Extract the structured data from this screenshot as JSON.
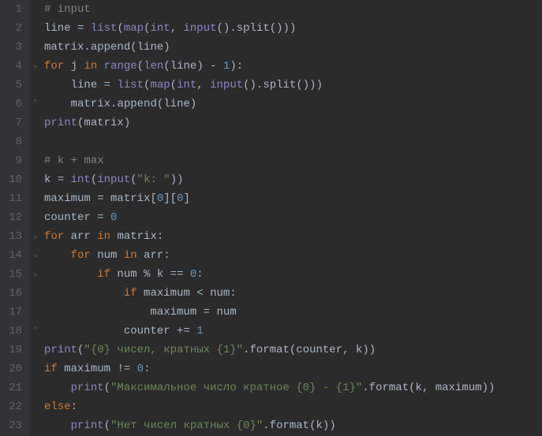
{
  "lines": [
    {
      "n": 1,
      "indent": 0,
      "fold": "",
      "tokens": [
        [
          "comment",
          "# input"
        ]
      ]
    },
    {
      "n": 2,
      "indent": 0,
      "fold": "",
      "tokens": [
        [
          "ident",
          "line "
        ],
        [
          "punct",
          "= "
        ],
        [
          "builtin",
          "list"
        ],
        [
          "punct",
          "("
        ],
        [
          "builtin",
          "map"
        ],
        [
          "punct",
          "("
        ],
        [
          "builtin",
          "int"
        ],
        [
          "punct",
          ", "
        ],
        [
          "builtin",
          "input"
        ],
        [
          "punct",
          "()."
        ],
        [
          "ident",
          "split"
        ],
        [
          "punct",
          "()))"
        ]
      ]
    },
    {
      "n": 3,
      "indent": 0,
      "fold": "",
      "tokens": [
        [
          "ident",
          "matrix"
        ],
        [
          "punct",
          "."
        ],
        [
          "ident",
          "append"
        ],
        [
          "punct",
          "("
        ],
        [
          "ident",
          "line"
        ],
        [
          "punct",
          ")"
        ]
      ]
    },
    {
      "n": 4,
      "indent": 0,
      "fold": "open",
      "tokens": [
        [
          "keyword",
          "for"
        ],
        [
          "ident",
          " j "
        ],
        [
          "keyword",
          "in"
        ],
        [
          "ident",
          " "
        ],
        [
          "builtin",
          "range"
        ],
        [
          "punct",
          "("
        ],
        [
          "builtin",
          "len"
        ],
        [
          "punct",
          "("
        ],
        [
          "ident",
          "line"
        ],
        [
          "punct",
          ") - "
        ],
        [
          "number",
          "1"
        ],
        [
          "punct",
          "):"
        ]
      ]
    },
    {
      "n": 5,
      "indent": 1,
      "fold": "",
      "tokens": [
        [
          "ident",
          "line "
        ],
        [
          "punct",
          "= "
        ],
        [
          "builtin",
          "list"
        ],
        [
          "punct",
          "("
        ],
        [
          "builtin",
          "map"
        ],
        [
          "punct",
          "("
        ],
        [
          "builtin",
          "int"
        ],
        [
          "punct",
          ", "
        ],
        [
          "builtin",
          "input"
        ],
        [
          "punct",
          "()."
        ],
        [
          "ident",
          "split"
        ],
        [
          "punct",
          "()))"
        ]
      ]
    },
    {
      "n": 6,
      "indent": 1,
      "fold": "close",
      "tokens": [
        [
          "ident",
          "matrix"
        ],
        [
          "punct",
          "."
        ],
        [
          "ident",
          "append"
        ],
        [
          "punct",
          "("
        ],
        [
          "ident",
          "line"
        ],
        [
          "punct",
          ")"
        ]
      ]
    },
    {
      "n": 7,
      "indent": 0,
      "fold": "",
      "tokens": [
        [
          "builtin",
          "print"
        ],
        [
          "punct",
          "("
        ],
        [
          "ident",
          "matrix"
        ],
        [
          "punct",
          ")"
        ]
      ]
    },
    {
      "n": 8,
      "indent": 0,
      "fold": "",
      "tokens": []
    },
    {
      "n": 9,
      "indent": 0,
      "fold": "",
      "tokens": [
        [
          "comment",
          "# k + max"
        ]
      ]
    },
    {
      "n": 10,
      "indent": 0,
      "fold": "",
      "tokens": [
        [
          "ident",
          "k "
        ],
        [
          "punct",
          "= "
        ],
        [
          "builtin",
          "int"
        ],
        [
          "punct",
          "("
        ],
        [
          "builtin",
          "input"
        ],
        [
          "punct",
          "("
        ],
        [
          "string",
          "\"k: \""
        ],
        [
          "punct",
          "))"
        ]
      ]
    },
    {
      "n": 11,
      "indent": 0,
      "fold": "",
      "tokens": [
        [
          "ident",
          "maximum "
        ],
        [
          "punct",
          "= "
        ],
        [
          "ident",
          "matrix"
        ],
        [
          "punct",
          "["
        ],
        [
          "number",
          "0"
        ],
        [
          "punct",
          "]["
        ],
        [
          "number",
          "0"
        ],
        [
          "punct",
          "]"
        ]
      ]
    },
    {
      "n": 12,
      "indent": 0,
      "fold": "",
      "tokens": [
        [
          "ident",
          "counter "
        ],
        [
          "punct",
          "= "
        ],
        [
          "number",
          "0"
        ]
      ]
    },
    {
      "n": 13,
      "indent": 0,
      "fold": "open",
      "tokens": [
        [
          "keyword",
          "for"
        ],
        [
          "ident",
          " arr "
        ],
        [
          "keyword",
          "in"
        ],
        [
          "ident",
          " matrix"
        ],
        [
          "punct",
          ":"
        ]
      ]
    },
    {
      "n": 14,
      "indent": 1,
      "fold": "open",
      "tokens": [
        [
          "keyword",
          "for"
        ],
        [
          "ident",
          " num "
        ],
        [
          "keyword",
          "in"
        ],
        [
          "ident",
          " arr"
        ],
        [
          "punct",
          ":"
        ]
      ]
    },
    {
      "n": 15,
      "indent": 2,
      "fold": "open",
      "tokens": [
        [
          "keyword",
          "if"
        ],
        [
          "ident",
          " num "
        ],
        [
          "punct",
          "% "
        ],
        [
          "ident",
          "k "
        ],
        [
          "punct",
          "== "
        ],
        [
          "number",
          "0"
        ],
        [
          "punct",
          ":"
        ]
      ]
    },
    {
      "n": 16,
      "indent": 3,
      "fold": "",
      "tokens": [
        [
          "keyword",
          "if"
        ],
        [
          "ident",
          " maximum "
        ],
        [
          "punct",
          "< "
        ],
        [
          "ident",
          "num"
        ],
        [
          "punct",
          ":"
        ]
      ]
    },
    {
      "n": 17,
      "indent": 4,
      "fold": "",
      "tokens": [
        [
          "ident",
          "maximum "
        ],
        [
          "punct",
          "= "
        ],
        [
          "ident",
          "num"
        ]
      ]
    },
    {
      "n": 18,
      "indent": 3,
      "fold": "close",
      "tokens": [
        [
          "ident",
          "counter "
        ],
        [
          "punct",
          "+= "
        ],
        [
          "number",
          "1"
        ]
      ]
    },
    {
      "n": 19,
      "indent": 0,
      "fold": "",
      "tokens": [
        [
          "builtin",
          "print"
        ],
        [
          "punct",
          "("
        ],
        [
          "string",
          "\"{0} чисел, кратных {1}\""
        ],
        [
          "punct",
          "."
        ],
        [
          "ident",
          "format"
        ],
        [
          "punct",
          "("
        ],
        [
          "ident",
          "counter"
        ],
        [
          "punct",
          ", "
        ],
        [
          "ident",
          "k"
        ],
        [
          "punct",
          "))"
        ]
      ]
    },
    {
      "n": 20,
      "indent": 0,
      "fold": "",
      "tokens": [
        [
          "keyword",
          "if"
        ],
        [
          "ident",
          " maximum "
        ],
        [
          "punct",
          "!= "
        ],
        [
          "number",
          "0"
        ],
        [
          "punct",
          ":"
        ]
      ]
    },
    {
      "n": 21,
      "indent": 1,
      "fold": "",
      "tokens": [
        [
          "builtin",
          "print"
        ],
        [
          "punct",
          "("
        ],
        [
          "string",
          "\"Максимальное число кратное {0} - {1}\""
        ],
        [
          "punct",
          "."
        ],
        [
          "ident",
          "format"
        ],
        [
          "punct",
          "("
        ],
        [
          "ident",
          "k"
        ],
        [
          "punct",
          ", "
        ],
        [
          "ident",
          "maximum"
        ],
        [
          "punct",
          "))"
        ]
      ]
    },
    {
      "n": 22,
      "indent": 0,
      "fold": "",
      "tokens": [
        [
          "keyword",
          "else"
        ],
        [
          "punct",
          ":"
        ]
      ]
    },
    {
      "n": 23,
      "indent": 1,
      "fold": "",
      "tokens": [
        [
          "builtin",
          "print"
        ],
        [
          "punct",
          "("
        ],
        [
          "string",
          "\"Нет чисел кратных {0}\""
        ],
        [
          "punct",
          "."
        ],
        [
          "ident",
          "format"
        ],
        [
          "punct",
          "("
        ],
        [
          "ident",
          "k"
        ],
        [
          "punct",
          "))"
        ]
      ]
    }
  ],
  "indent_unit": "    ",
  "fold_glyphs": {
    "open": "⌄",
    "close": "⌃"
  }
}
